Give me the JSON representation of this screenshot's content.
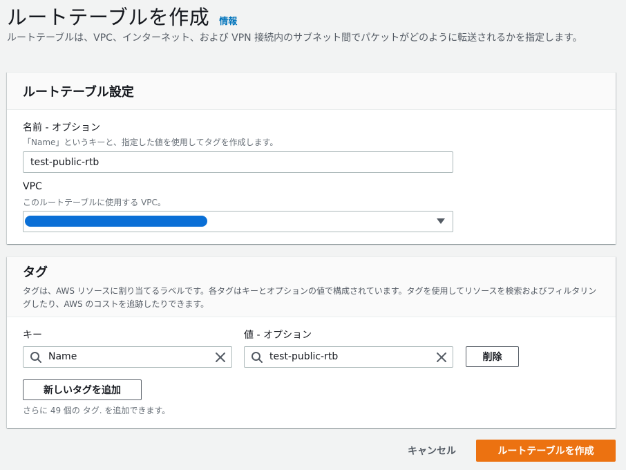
{
  "header": {
    "title": "ルートテーブルを作成",
    "info_link": "情報",
    "description": "ルートテーブルは、VPC、インターネット、および VPN 接続内のサブネット間でパケットがどのように転送されるかを指定します。"
  },
  "settings": {
    "title": "ルートテーブル設定",
    "name_field": {
      "label": "名前 - オプション",
      "description": "「Name」というキーと、指定した値を使用してタグを作成します。",
      "value": "test-public-rtb"
    },
    "vpc_field": {
      "label": "VPC",
      "description": "このルートテーブルに使用する VPC。",
      "selected_value_redacted": true
    }
  },
  "tags": {
    "title": "タグ",
    "description": "タグは、AWS リソースに割り当てるラベルです。各タグはキーとオプションの値で構成されています。タグを使用してリソースを検索およびフィルタリングしたり、AWS のコストを追跡したりできます。",
    "key_label": "キー",
    "value_label": "値 - オプション",
    "rows": [
      {
        "key": "Name",
        "value": "test-public-rtb",
        "remove_label": "削除"
      }
    ],
    "add_button": "新しいタグを追加",
    "remaining_hint": "さらに 49 個の タグ. を追加できます。"
  },
  "footer": {
    "cancel_label": "キャンセル",
    "create_label": "ルートテーブルを作成"
  },
  "colors": {
    "primary": "#ec7211",
    "link": "#0073bb",
    "redaction": "#0a6fd6"
  }
}
